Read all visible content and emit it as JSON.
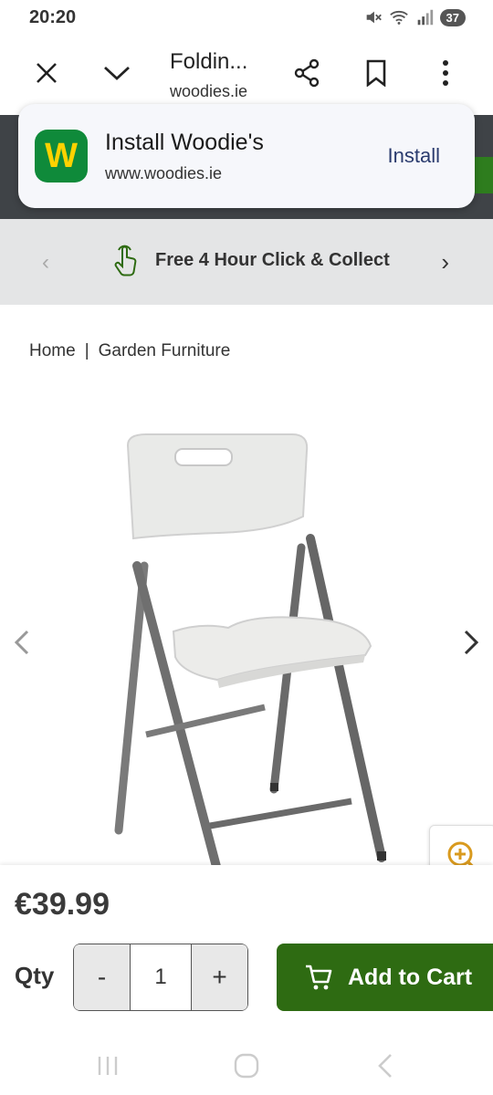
{
  "status_bar": {
    "time": "20:20",
    "battery": "37",
    "icons": [
      "mute-icon",
      "wifi-icon",
      "signal-icon"
    ]
  },
  "toolbar": {
    "title": "Foldin...",
    "domain": "woodies.ie",
    "icons": [
      "close-icon",
      "chevron-down-icon",
      "share-icon",
      "bookmark-icon",
      "more-vert-icon"
    ]
  },
  "install_prompt": {
    "logo_letter": "W",
    "title": "Install Woodie's",
    "url": "www.woodies.ie",
    "button": "Install"
  },
  "promo": {
    "text": "Free 4 Hour Click & Collect",
    "icon": "touch-hand-icon"
  },
  "breadcrumb": {
    "home": "Home",
    "separator": "|",
    "category": "Garden Furniture"
  },
  "product": {
    "image": "folding-chair-image",
    "price": "€39.99",
    "qty_label": "Qty",
    "qty_minus": "-",
    "qty_value": "1",
    "qty_plus": "+",
    "add_to_cart": "Add to Cart"
  },
  "colors": {
    "brand_green": "#2e6b12",
    "logo_green": "#0f8a3a",
    "logo_yellow": "#ffd200",
    "header_dark": "#3f4347"
  }
}
